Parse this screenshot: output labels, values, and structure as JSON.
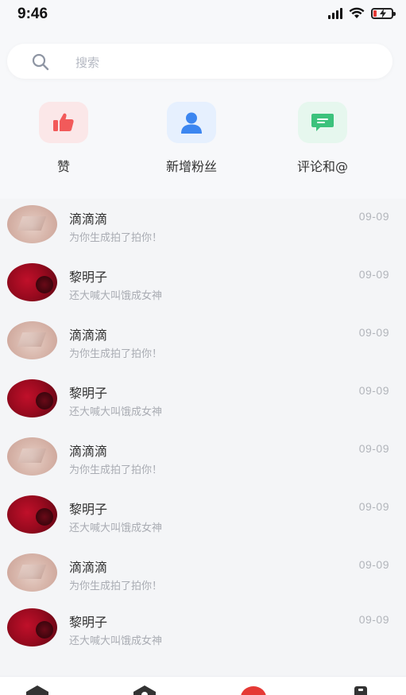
{
  "status_bar": {
    "time": "9:46"
  },
  "search": {
    "placeholder": "搜索"
  },
  "quick_actions": [
    {
      "label": "赞",
      "icon": "thumbs-up-icon",
      "bg": "#fbe7e8",
      "color": "#f25a5a"
    },
    {
      "label": "新增粉丝",
      "icon": "user-icon",
      "bg": "#e6f0fe",
      "color": "#3c86f0"
    },
    {
      "label": "评论和@",
      "icon": "comment-icon",
      "bg": "#e6f7ee",
      "color": "#3cc27c"
    }
  ],
  "messages": [
    {
      "name": "滴滴滴",
      "text": "为你生成拍了拍你！",
      "date": "09-09",
      "avatar": "a"
    },
    {
      "name": "黎明子",
      "text": "还大喊大叫饿成女神",
      "date": "09-09",
      "avatar": "b"
    },
    {
      "name": "滴滴滴",
      "text": "为你生成拍了拍你！",
      "date": "09-09",
      "avatar": "a"
    },
    {
      "name": "黎明子",
      "text": "还大喊大叫饿成女神",
      "date": "09-09",
      "avatar": "b"
    },
    {
      "name": "滴滴滴",
      "text": "为你生成拍了拍你！",
      "date": "09-09",
      "avatar": "a"
    },
    {
      "name": "黎明子",
      "text": "还大喊大叫饿成女神",
      "date": "09-09",
      "avatar": "b"
    },
    {
      "name": "滴滴滴",
      "text": "为你生成拍了拍你！",
      "date": "09-09",
      "avatar": "a"
    },
    {
      "name": "黎明子",
      "text": "还大喊大叫饿成女神",
      "date": "09-09",
      "avatar": "b"
    }
  ],
  "tabbar": {
    "icons": [
      "home-icon",
      "discover-icon",
      "publish-icon",
      "profile-icon"
    ],
    "accent": "#e53935"
  }
}
